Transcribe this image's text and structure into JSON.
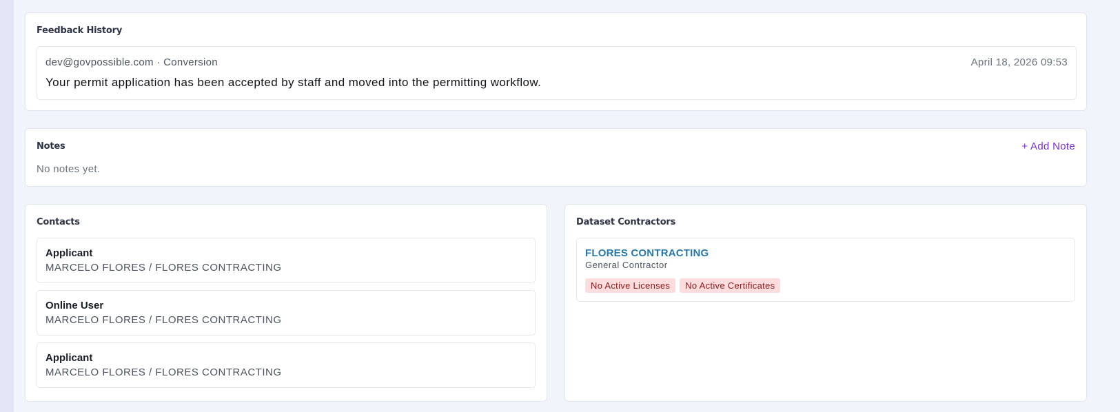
{
  "feedback": {
    "title": "Feedback History",
    "entries": [
      {
        "author": "dev@govpossible.com · Conversion",
        "date": "April 18, 2026 09:53",
        "message": "Your permit application has been accepted by staff and moved into the permitting workflow."
      }
    ]
  },
  "notes": {
    "title": "Notes",
    "add_label": "+ Add Note",
    "empty_text": "No notes yet."
  },
  "contacts": {
    "title": "Contacts",
    "items": [
      {
        "role": "Applicant",
        "name": "MARCELO FLORES / FLORES CONTRACTING"
      },
      {
        "role": "Online User",
        "name": "MARCELO FLORES / FLORES CONTRACTING"
      },
      {
        "role": "Applicant",
        "name": "MARCELO FLORES / FLORES CONTRACTING"
      }
    ]
  },
  "contractors": {
    "title": "Dataset Contractors",
    "items": [
      {
        "name": "FLORES CONTRACTING",
        "type": "General Contractor",
        "badges": [
          "No Active Licenses",
          "No Active Certificates"
        ]
      }
    ]
  },
  "colors": {
    "accent": "#7a2ed0",
    "link": "#2778a6",
    "badge_bg": "#fcdcdc",
    "badge_text": "#8b1a1a"
  }
}
